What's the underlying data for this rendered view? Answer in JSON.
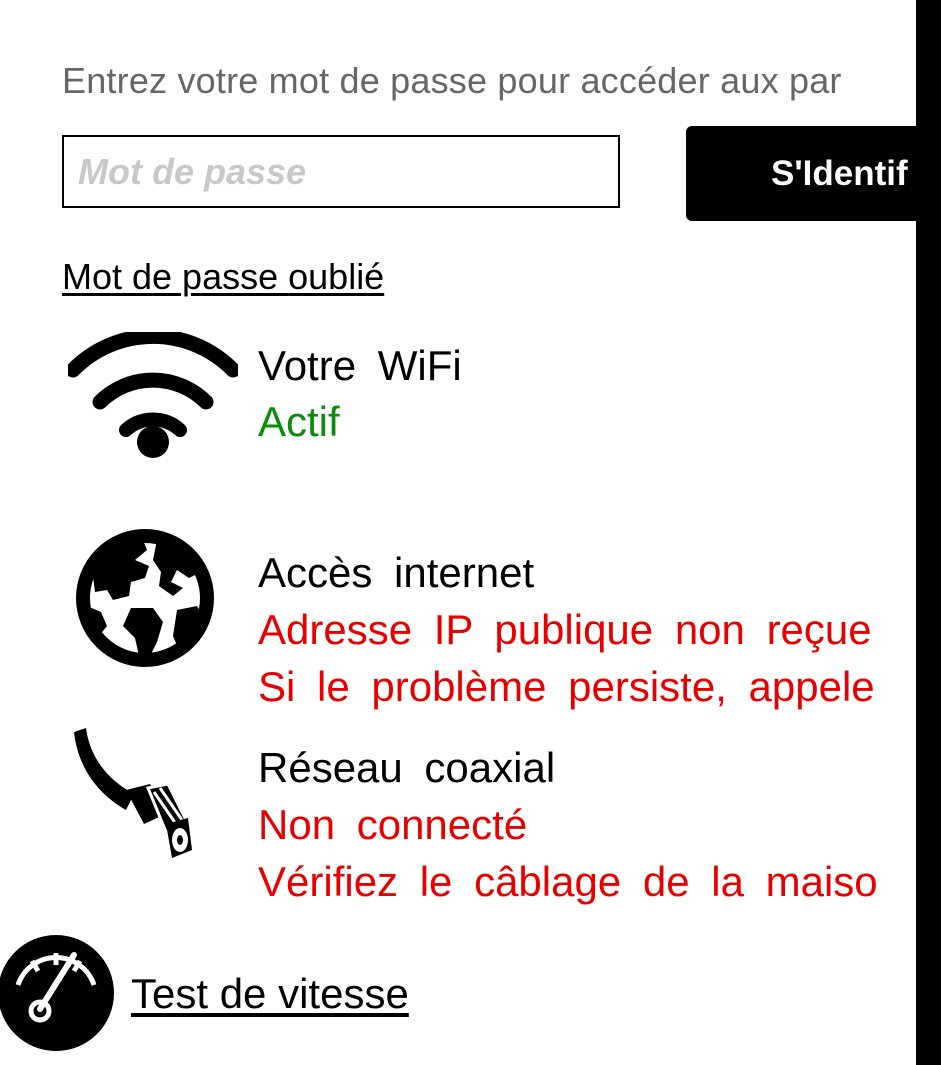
{
  "login": {
    "intro_text": "Entrez votre mot de passe pour accéder aux par",
    "password_placeholder": "Mot de passe",
    "login_button_label": "S'Identif",
    "forgot_password_label": "Mot de passe oublié"
  },
  "statuses": {
    "wifi": {
      "icon": "wifi-icon",
      "title": "Votre  WiFi",
      "state": "Actif",
      "state_color": "#0b8a0b"
    },
    "internet": {
      "icon": "globe-icon",
      "title": "Accès  internet",
      "state": "Adresse  IP  publique  non  reçue",
      "hint": "Si  le  problème  persiste,  appele",
      "state_color": "#e60000"
    },
    "coax": {
      "icon": "coax-cable-icon",
      "title": "Réseau  coaxial",
      "state": "Non  connecté",
      "hint": "Vérifiez  le  câblage  de  la  maiso",
      "state_color": "#e60000"
    }
  },
  "speedtest": {
    "icon": "speedometer-icon",
    "label": "Test de vitesse"
  }
}
